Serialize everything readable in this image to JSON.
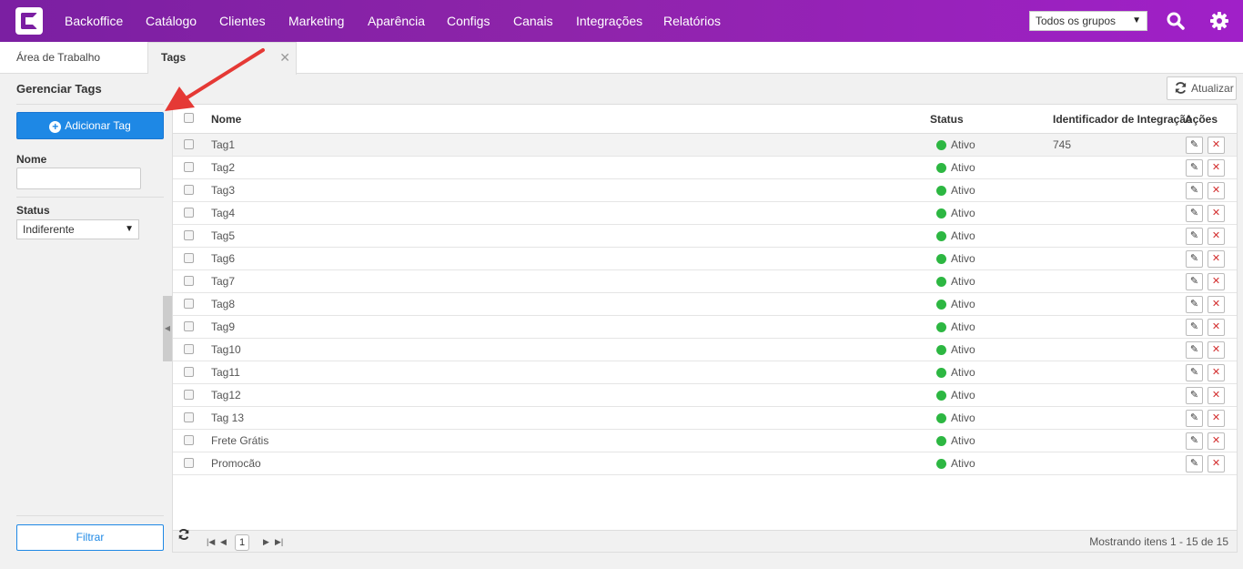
{
  "nav": {
    "items": [
      "Backoffice",
      "Catálogo",
      "Clientes",
      "Marketing",
      "Aparência",
      "Configs",
      "Canais",
      "Integrações",
      "Relatórios"
    ],
    "group_select": "Todos os grupos"
  },
  "tabs": {
    "workspace": "Área de Trabalho",
    "active": "Tags",
    "close_glyph": "✕"
  },
  "panel": {
    "title": "Gerenciar Tags",
    "add_button": "Adicionar Tag",
    "name_label": "Nome",
    "name_value": "",
    "status_label": "Status",
    "status_value": "Indiferente",
    "filter_button": "Filtrar"
  },
  "toolbar": {
    "refresh_label": "Atualizar"
  },
  "table": {
    "columns": [
      "Nome",
      "Status",
      "Identificador de Integração",
      "Ações"
    ],
    "rows": [
      {
        "name": "Tag1",
        "status": "Ativo",
        "integration_id": "745"
      },
      {
        "name": "Tag2",
        "status": "Ativo",
        "integration_id": ""
      },
      {
        "name": "Tag3",
        "status": "Ativo",
        "integration_id": ""
      },
      {
        "name": "Tag4",
        "status": "Ativo",
        "integration_id": ""
      },
      {
        "name": "Tag5",
        "status": "Ativo",
        "integration_id": ""
      },
      {
        "name": "Tag6",
        "status": "Ativo",
        "integration_id": ""
      },
      {
        "name": "Tag7",
        "status": "Ativo",
        "integration_id": ""
      },
      {
        "name": "Tag8",
        "status": "Ativo",
        "integration_id": ""
      },
      {
        "name": "Tag9",
        "status": "Ativo",
        "integration_id": ""
      },
      {
        "name": "Tag10",
        "status": "Ativo",
        "integration_id": ""
      },
      {
        "name": "Tag11",
        "status": "Ativo",
        "integration_id": ""
      },
      {
        "name": "Tag12",
        "status": "Ativo",
        "integration_id": ""
      },
      {
        "name": "Tag 13",
        "status": "Ativo",
        "integration_id": ""
      },
      {
        "name": "Frete Grátis",
        "status": "Ativo",
        "integration_id": ""
      },
      {
        "name": "Promocão",
        "status": "Ativo",
        "integration_id": ""
      }
    ]
  },
  "pager": {
    "current_page": "1",
    "info": "Mostrando itens 1 - 15 de 15"
  },
  "colors": {
    "brand": "#8e24aa",
    "primary": "#1e88e5",
    "status_active": "#2db742",
    "annotation_arrow": "#e53935"
  },
  "icons": [
    "logo-icon",
    "search-icon",
    "gear-icon",
    "plus-circle-icon",
    "refresh-icon",
    "pencil-icon",
    "delete-icon",
    "close-icon"
  ]
}
